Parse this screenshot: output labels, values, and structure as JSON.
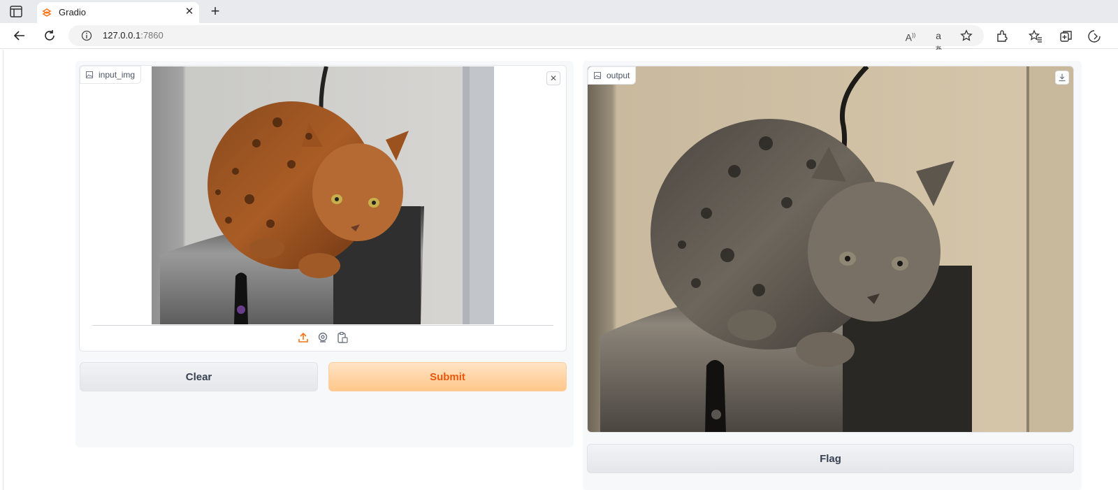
{
  "browser": {
    "tab_title": "Gradio",
    "url_host": "127.0.0.1",
    "url_port": ":7860"
  },
  "input_block": {
    "label": "input_img",
    "image_description": "cat-photo",
    "source_icons": [
      "upload-icon",
      "webcam-icon",
      "clipboard-icon"
    ]
  },
  "output_block": {
    "label": "output"
  },
  "buttons": {
    "clear": "Clear",
    "submit": "Submit",
    "flag": "Flag"
  },
  "colors": {
    "accent": "#ea580c",
    "submit_bg": "#ffd3a6"
  }
}
